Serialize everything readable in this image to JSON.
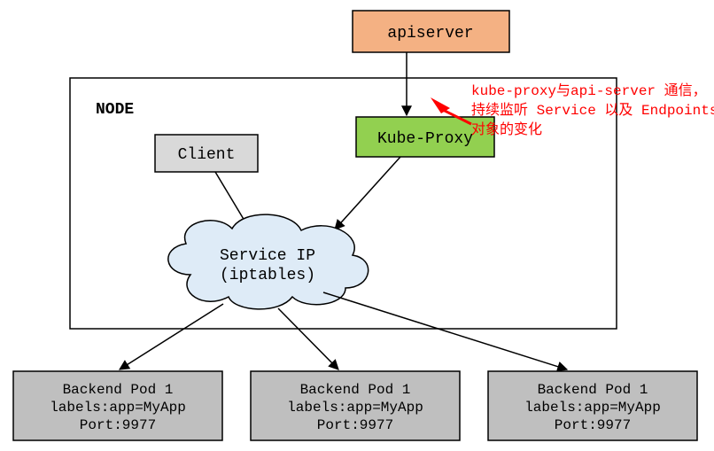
{
  "apiserver": {
    "label": "apiserver"
  },
  "node": {
    "label": "NODE"
  },
  "client": {
    "label": "Client"
  },
  "kubeproxy": {
    "label": "Kube-Proxy"
  },
  "serviceip": {
    "line1": "Service IP",
    "line2": "(iptables)"
  },
  "annotation": {
    "line1": "kube-proxy与api-server 通信，",
    "line2": "持续监听 Service 以及 Endpoints",
    "line3": "对象的变化"
  },
  "pods": [
    {
      "title": "Backend Pod 1",
      "labels": "labels:app=MyApp",
      "port": "Port:9977"
    },
    {
      "title": "Backend Pod 1",
      "labels": "labels:app=MyApp",
      "port": "Port:9977"
    },
    {
      "title": "Backend Pod 1",
      "labels": "labels:app=MyApp",
      "port": "Port:9977"
    }
  ],
  "colors": {
    "apiserver_fill": "#f4b183",
    "kubeproxy_fill": "#92d050",
    "neutral_fill": "#d9d9d9",
    "pod_fill": "#bfbfbf",
    "cloud_fill": "#deebf7",
    "border": "#000000",
    "anno": "#ff0000"
  }
}
